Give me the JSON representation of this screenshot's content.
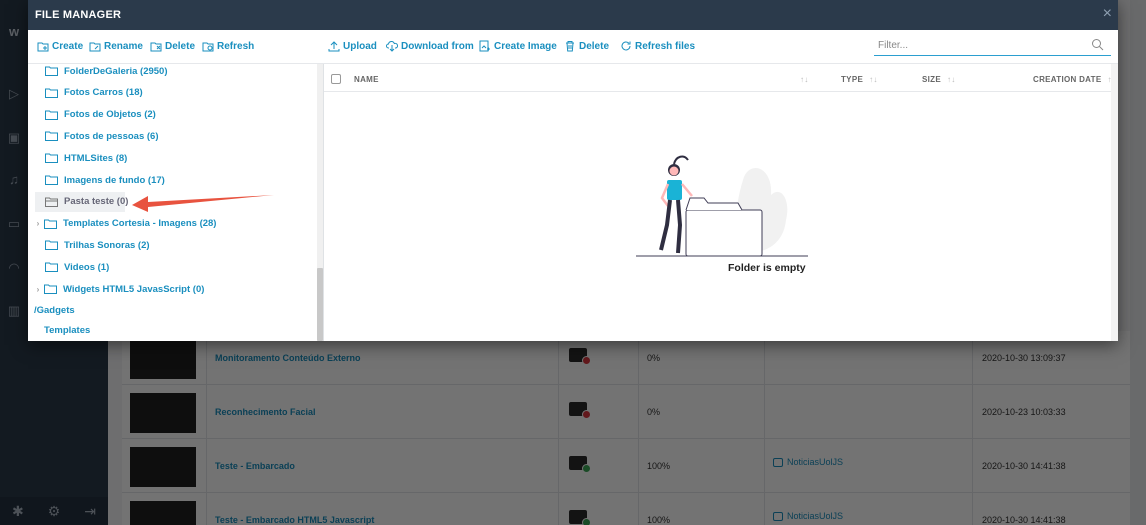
{
  "modal": {
    "title": "FILE MANAGER",
    "close": "×",
    "toolbar_left": [
      {
        "label": "Create",
        "icon": "folder-add-icon"
      },
      {
        "label": "Rename",
        "icon": "folder-rename-icon"
      },
      {
        "label": "Delete",
        "icon": "folder-delete-icon"
      },
      {
        "label": "Refresh",
        "icon": "folder-refresh-icon"
      }
    ],
    "toolbar_right": [
      {
        "label": "Upload",
        "icon": "upload-icon"
      },
      {
        "label": "Download from",
        "icon": "cloud-download-icon"
      },
      {
        "label": "Create Image",
        "icon": "create-image-icon"
      },
      {
        "label": "Delete",
        "icon": "trash-icon"
      },
      {
        "label": "Refresh files",
        "icon": "refresh-icon"
      }
    ],
    "filter_placeholder": "Filter..."
  },
  "tree": {
    "items": [
      {
        "label": "FolderDeGaleria (2950)",
        "has_children": false
      },
      {
        "label": "Fotos Carros (18)",
        "has_children": false
      },
      {
        "label": "Fotos de Objetos (2)",
        "has_children": false
      },
      {
        "label": "Fotos de pessoas (6)",
        "has_children": false
      },
      {
        "label": "HTMLSites (8)",
        "has_children": false
      },
      {
        "label": "Imagens de fundo (17)",
        "has_children": false
      },
      {
        "label": "Pasta teste (0)",
        "has_children": false,
        "selected": true
      },
      {
        "label": "Templates Cortesia - Imagens (28)",
        "has_children": true
      },
      {
        "label": "Trilhas Sonoras (2)",
        "has_children": false
      },
      {
        "label": "Videos (1)",
        "has_children": false
      },
      {
        "label": "Widgets HTML5 JavasScript (0)",
        "has_children": true
      }
    ],
    "root_gadgets": "/Gadgets",
    "templates": "Templates"
  },
  "columns": {
    "name": "NAME",
    "type": "TYPE",
    "size": "SIZE",
    "date": "CREATION DATE"
  },
  "empty_message": "Folder is empty",
  "background_rows": [
    {
      "name": "Monitoramento Conteúdo Externo",
      "progress": "0%",
      "link": "",
      "date": "2020-10-30 13:09:37",
      "status": "error"
    },
    {
      "name": "Reconhecimento Facial",
      "progress": "0%",
      "link": "",
      "date": "2020-10-23 10:03:33",
      "status": "error"
    },
    {
      "name": "Teste - Embarcado",
      "progress": "100%",
      "link": "NoticiasUolJS",
      "date": "2020-10-30 14:41:38",
      "status": "ok"
    },
    {
      "name": "Teste - Embarcado HTML5 Javascript",
      "progress": "100%",
      "link": "NoticiasUolJS",
      "date": "2020-10-30 14:41:38",
      "status": "ok"
    }
  ],
  "colors": {
    "accent": "#1a8fbf",
    "header": "#2b3a4b",
    "arrow": "#e8533f",
    "error": "#d9363e",
    "ok": "#3aa655"
  }
}
